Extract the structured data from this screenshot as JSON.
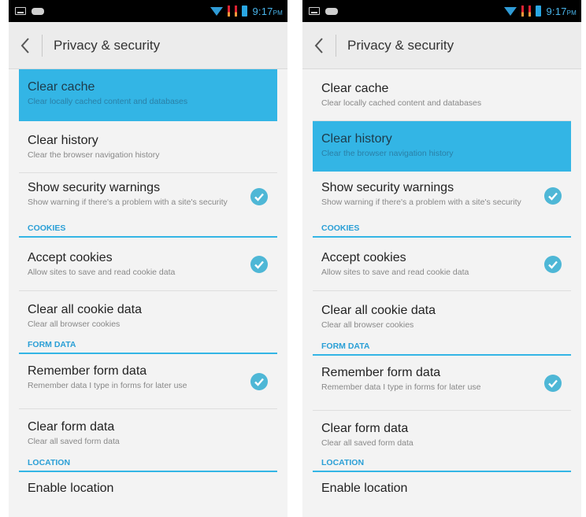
{
  "status_bar": {
    "time": "9:17",
    "ampm": "PM"
  },
  "action_bar": {
    "title": "Privacy & security"
  },
  "items": {
    "clear_cache": {
      "title": "Clear cache",
      "summary": "Clear locally cached content and databases"
    },
    "clear_history": {
      "title": "Clear history",
      "summary": "Clear the browser navigation history"
    },
    "security_warnings": {
      "title": "Show security warnings",
      "summary": "Show warning if there's a problem with a site's security",
      "checked": true
    },
    "accept_cookies": {
      "title": "Accept cookies",
      "summary": "Allow sites to save and read cookie data",
      "checked": true
    },
    "clear_cookies": {
      "title": "Clear all cookie data",
      "summary": "Clear all browser cookies"
    },
    "remember_form": {
      "title": "Remember form data",
      "summary": "Remember data I type in forms for later use",
      "checked": true
    },
    "clear_form": {
      "title": "Clear form data",
      "summary": "Clear all saved form data"
    },
    "enable_location": {
      "title": "Enable location"
    }
  },
  "categories": {
    "cookies": "COOKIES",
    "form_data": "FORM DATA",
    "location": "LOCATION"
  },
  "screens": [
    {
      "selected_item": "clear_cache"
    },
    {
      "selected_item": "clear_history"
    }
  ],
  "colors": {
    "accent": "#33b5e5",
    "check": "#4eb7d6",
    "category_text": "#2a9fd6",
    "background": "#f3f3f3"
  }
}
